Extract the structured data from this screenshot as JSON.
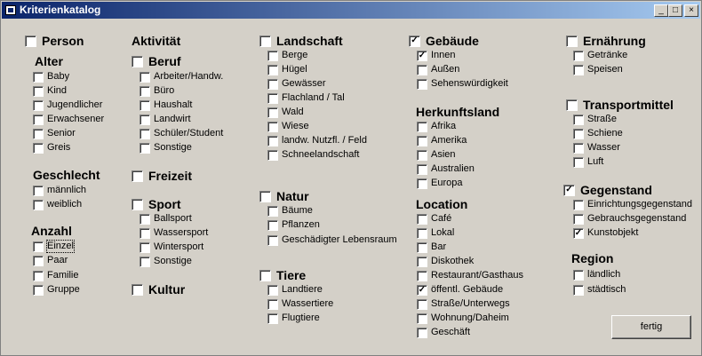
{
  "window": {
    "title": "Kriterienkatalog",
    "min": "_",
    "max": "□",
    "close": "×"
  },
  "checkmark": "✓",
  "groups": [
    {
      "label": "Person",
      "checked": false,
      "large": true
    },
    {
      "label": "Alter",
      "checked": false,
      "nocheck": true
    },
    {
      "label": "Baby",
      "checked": false
    },
    {
      "label": "Kind",
      "checked": false
    },
    {
      "label": "Jugendlicher",
      "checked": false
    },
    {
      "label": "Erwachsener",
      "checked": false
    },
    {
      "label": "Senior",
      "checked": false
    },
    {
      "label": "Greis",
      "checked": false
    },
    {
      "label": "Geschlecht",
      "nocheck": true
    },
    {
      "label": "männlich",
      "checked": false
    },
    {
      "label": "weiblich",
      "checked": false
    },
    {
      "label": "Anzahl",
      "nocheck": true
    },
    {
      "label": "Einzel",
      "checked": false
    },
    {
      "label": "Paar",
      "checked": false
    },
    {
      "label": "Familie",
      "checked": false
    },
    {
      "label": "Gruppe",
      "checked": false
    },
    {
      "label": "Aktivität",
      "nocheck": true
    },
    {
      "label": "Beruf",
      "checked": false,
      "large": true
    },
    {
      "label": "Arbeiter/Handw.",
      "checked": false
    },
    {
      "label": "Büro",
      "checked": false
    },
    {
      "label": "Haushalt",
      "checked": false
    },
    {
      "label": "Landwirt",
      "checked": false
    },
    {
      "label": "Schüler/Student",
      "checked": false
    },
    {
      "label": "Sonstige",
      "checked": false
    },
    {
      "label": "Freizeit",
      "checked": false,
      "large": true
    },
    {
      "label": "Sport",
      "checked": false,
      "large": true
    },
    {
      "label": "Ballsport",
      "checked": false
    },
    {
      "label": "Wassersport",
      "checked": false
    },
    {
      "label": "Wintersport",
      "checked": false
    },
    {
      "label": "Sonstige",
      "checked": false
    },
    {
      "label": "Kultur",
      "checked": false,
      "large": true
    },
    {
      "label": "Landschaft",
      "checked": false,
      "large": true
    },
    {
      "label": "Berge",
      "checked": false
    },
    {
      "label": "Hügel",
      "checked": false
    },
    {
      "label": "Gewässer",
      "checked": false
    },
    {
      "label": "Flachland / Tal",
      "checked": false
    },
    {
      "label": "Wald",
      "checked": false
    },
    {
      "label": "Wiese",
      "checked": false
    },
    {
      "label": "landw. Nutzfl. / Feld",
      "checked": false
    },
    {
      "label": "Schneelandschaft",
      "checked": false
    },
    {
      "label": "Natur",
      "checked": false,
      "large": true
    },
    {
      "label": "Bäume",
      "checked": false
    },
    {
      "label": "Pflanzen",
      "checked": false
    },
    {
      "label": "Geschädigter Lebensraum",
      "checked": false
    },
    {
      "label": "Tiere",
      "checked": false,
      "large": true
    },
    {
      "label": "Landtiere",
      "checked": false
    },
    {
      "label": "Wassertiere",
      "checked": false
    },
    {
      "label": "Flugtiere",
      "checked": false
    },
    {
      "label": "Gebäude",
      "checked": true,
      "large": true
    },
    {
      "label": "Innen",
      "checked": true
    },
    {
      "label": "Außen",
      "checked": false
    },
    {
      "label": "Sehenswürdigkeit",
      "checked": false
    },
    {
      "label": "Herkunftsland",
      "nocheck": true
    },
    {
      "label": "Afrika",
      "checked": false
    },
    {
      "label": "Amerika",
      "checked": false
    },
    {
      "label": "Asien",
      "checked": false
    },
    {
      "label": "Australien",
      "checked": false
    },
    {
      "label": "Europa",
      "checked": false
    },
    {
      "label": "Location",
      "nocheck": true
    },
    {
      "label": "Café",
      "checked": false
    },
    {
      "label": "Lokal",
      "checked": false
    },
    {
      "label": "Bar",
      "checked": false
    },
    {
      "label": "Diskothek",
      "checked": false
    },
    {
      "label": "Restaurant/Gasthaus",
      "checked": false
    },
    {
      "label": "öffentl. Gebäude",
      "checked": true
    },
    {
      "label": "Straße/Unterwegs",
      "checked": false
    },
    {
      "label": "Wohnung/Daheim",
      "checked": false
    },
    {
      "label": "Geschäft",
      "checked": false
    },
    {
      "label": "Ernährung",
      "checked": false,
      "large": true
    },
    {
      "label": "Getränke",
      "checked": false
    },
    {
      "label": "Speisen",
      "checked": false
    },
    {
      "label": "Transportmittel",
      "checked": false,
      "large": true
    },
    {
      "label": "Straße",
      "checked": false
    },
    {
      "label": "Schiene",
      "checked": false
    },
    {
      "label": "Wasser",
      "checked": false
    },
    {
      "label": "Luft",
      "checked": false
    },
    {
      "label": "Gegenstand",
      "checked": true,
      "large": true
    },
    {
      "label": "Einrichtungsgegenstand",
      "checked": false
    },
    {
      "label": "Gebrauchsgegenstand",
      "checked": false
    },
    {
      "label": "Kunstobjekt",
      "checked": true
    },
    {
      "label": "Region",
      "nocheck": true
    },
    {
      "label": "ländlich",
      "checked": false
    },
    {
      "label": "städtisch",
      "checked": false
    }
  ],
  "done_button": "fertig"
}
